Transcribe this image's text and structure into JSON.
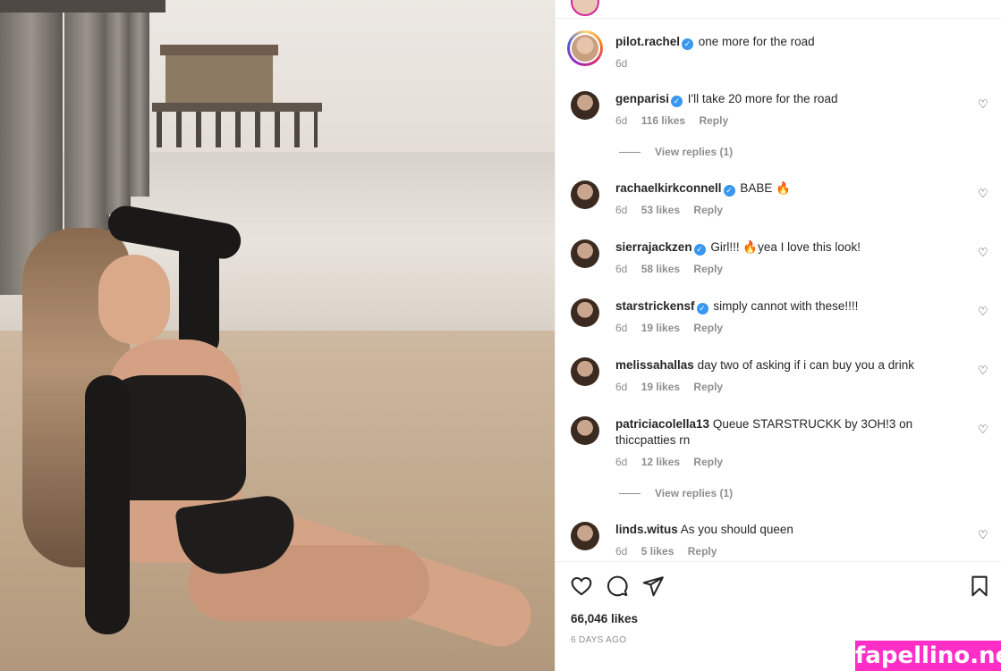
{
  "post": {
    "username": "pilot.rachel",
    "caption": "one more for the road",
    "age": "6d",
    "likes_total": "66,046 likes",
    "posted": "6 DAYS AGO"
  },
  "comments": [
    {
      "username": "genparisi",
      "verified": true,
      "text": "I'll take 20 more for the road",
      "age": "6d",
      "likes": "116 likes",
      "reply": "Reply",
      "view_replies": "View replies (1)"
    },
    {
      "username": "rachaelkirkconnell",
      "verified": true,
      "text": "BABE 🔥",
      "age": "6d",
      "likes": "53 likes",
      "reply": "Reply"
    },
    {
      "username": "sierrajackzen",
      "verified": true,
      "text": "Girl!!! 🔥yea I love this look!",
      "age": "6d",
      "likes": "58 likes",
      "reply": "Reply"
    },
    {
      "username": "starstrickensf",
      "verified": true,
      "text": "simply cannot with these!!!!",
      "age": "6d",
      "likes": "19 likes",
      "reply": "Reply"
    },
    {
      "username": "melissahallas",
      "verified": false,
      "text": "day two of asking if i can buy you a drink",
      "age": "6d",
      "likes": "19 likes",
      "reply": "Reply"
    },
    {
      "username": "patriciacolella13",
      "verified": false,
      "text": "Queue STARSTRUCKK by 3OH!3 on thiccpatties rn",
      "age": "6d",
      "likes": "12 likes",
      "reply": "Reply",
      "view_replies": "View replies (1)"
    },
    {
      "username": "linds.witus",
      "verified": false,
      "text": "As you should queen",
      "age": "6d",
      "likes": "5 likes",
      "reply": "Reply"
    }
  ],
  "icons": {
    "like": "heart-icon",
    "comment": "comment-icon",
    "share": "share-icon",
    "save": "bookmark-icon"
  },
  "watermark": "fapellino.net",
  "colors": {
    "verified": "#3897f0",
    "watermark_bg": "#ff2ec7",
    "muted": "#8e8e8e"
  }
}
